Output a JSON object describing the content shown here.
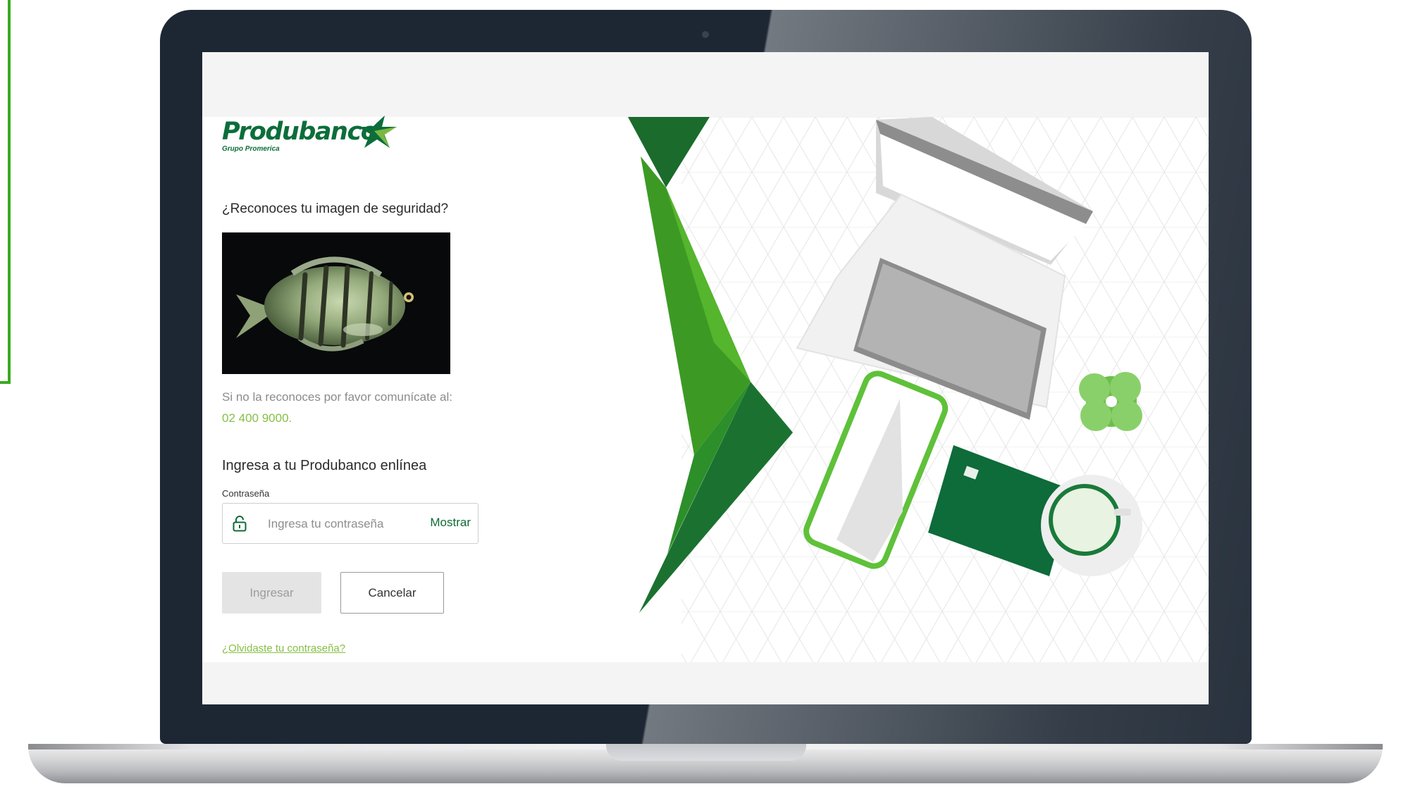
{
  "brand": {
    "name": "Produbanco",
    "tagline": "Grupo Promerica",
    "primary_color": "#0b6e3a",
    "accent_color": "#86c045"
  },
  "security_image": {
    "question": "¿Reconoces tu imagen de seguridad?",
    "subject_icon": "fish-image",
    "hint": "Si no la reconoces por favor comunícate al:",
    "phone": "02 400 9000."
  },
  "login": {
    "title": "Ingresa a tu Produbanco enlínea",
    "password_label": "Contraseña",
    "password_placeholder": "Ingresa tu contraseña",
    "password_value": "",
    "show_label": "Mostrar",
    "lock_icon": "lock-icon",
    "submit_label": "Ingresar",
    "submit_disabled": true,
    "cancel_label": "Cancelar",
    "forgot_label": "¿Olvidaste tu contraseña?"
  },
  "illustration": {
    "items": [
      "laptop-icon",
      "phone-icon",
      "card-icon",
      "flower-icon",
      "cup-icon"
    ]
  }
}
